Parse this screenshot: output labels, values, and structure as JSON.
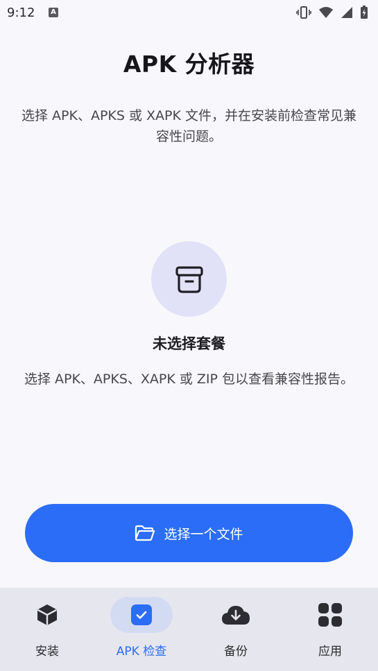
{
  "status_bar": {
    "time": "9:12",
    "left_icon": "A"
  },
  "header": {
    "title": "APK 分析器",
    "description": "选择 APK、APKS 或 XAPK 文件，并在安装前检查常见兼容性问题。"
  },
  "empty_state": {
    "icon": "archive-box-icon",
    "title": "未选择套餐",
    "description": "选择 APK、APKS、XAPK 或 ZIP 包以查看兼容性报告。"
  },
  "pick_button": {
    "icon": "folder-open-icon",
    "label": "选择一个文件"
  },
  "bottom_nav": {
    "items": [
      {
        "label": "安装",
        "icon": "package-icon",
        "active": false
      },
      {
        "label": "APK 检查",
        "icon": "checkbox-icon",
        "active": true
      },
      {
        "label": "备份",
        "icon": "cloud-download-icon",
        "active": false
      },
      {
        "label": "应用",
        "icon": "apps-grid-icon",
        "active": false
      }
    ]
  },
  "colors": {
    "accent": "#2b6df6",
    "background": "#f8f8fc",
    "nav_background": "#e6e6ee",
    "empty_icon_background": "#e1e2f7",
    "nav_active_pill": "#d3dbf2"
  }
}
